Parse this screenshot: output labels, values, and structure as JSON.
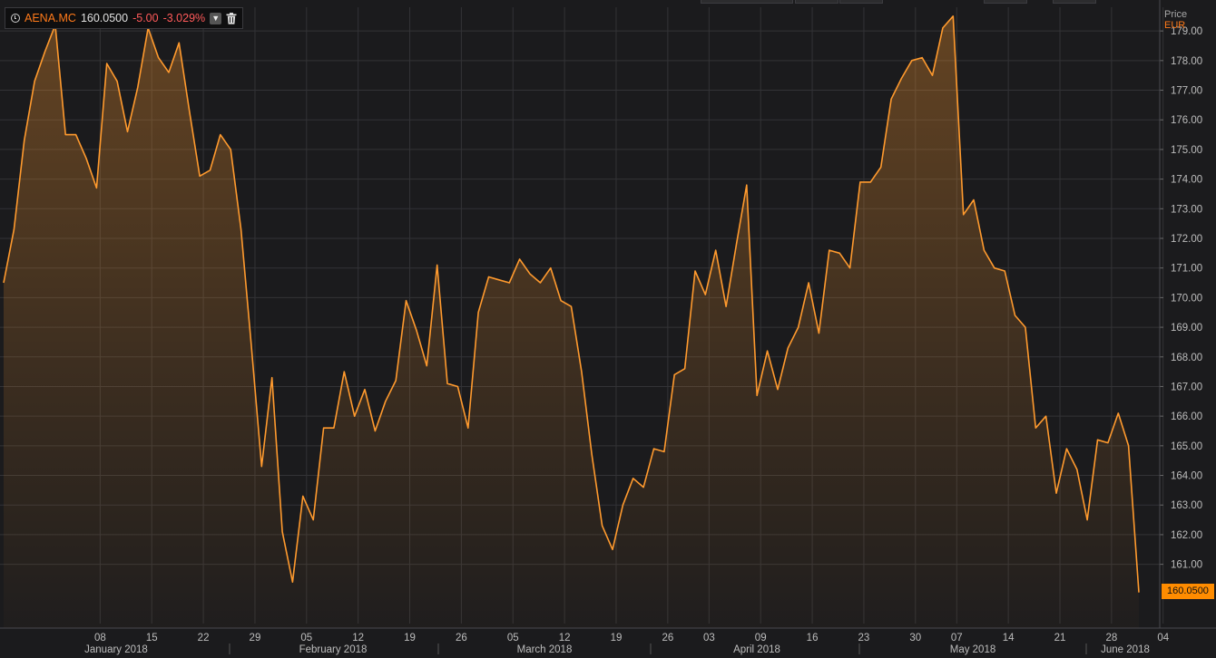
{
  "legend": {
    "ric": "AENA.MC",
    "last": "160.0500",
    "change": "-5.00",
    "change_pct": "-3.029%",
    "icons": [
      "clock-icon",
      "chevron-down-icon",
      "trash-icon"
    ]
  },
  "axis_header": {
    "title": "Price",
    "currency": "EUR"
  },
  "last_price_label": "160.0500",
  "colors": {
    "line": "#ff9a2e",
    "accent": "#ff7a1a",
    "negative": "#ff5a5a",
    "background": "#1b1b1d",
    "grid": "#333336"
  },
  "chart_data": {
    "type": "area",
    "ylim": [
      159.0,
      179.8
    ],
    "y_ticks": [
      "161.00",
      "162.00",
      "163.00",
      "164.00",
      "165.00",
      "166.00",
      "167.00",
      "168.00",
      "169.00",
      "170.00",
      "171.00",
      "172.00",
      "173.00",
      "174.00",
      "175.00",
      "176.00",
      "177.00",
      "178.00",
      "179.00"
    ],
    "day_ticks": [
      "08",
      "15",
      "22",
      "29",
      "05",
      "12",
      "19",
      "26",
      "05",
      "12",
      "19",
      "26",
      "03",
      "09",
      "16",
      "23",
      "30",
      "07",
      "14",
      "21",
      "28",
      "04"
    ],
    "month_labels": [
      "January 2018",
      "February 2018",
      "March 2018",
      "April 2018",
      "May 2018",
      "June 2018"
    ],
    "series": [
      {
        "values": [
          170.5,
          172.3,
          175.3,
          177.3,
          178.3,
          179.2,
          175.5,
          175.5,
          174.7,
          173.7,
          177.9,
          177.3,
          175.6,
          177.1,
          179.1,
          178.1,
          177.6,
          178.6,
          176.3,
          174.1,
          174.3,
          175.5,
          175.0,
          172.3,
          168.4,
          164.3,
          167.3,
          162.1,
          160.4,
          163.3,
          162.5,
          165.6,
          165.6,
          167.5,
          166.0,
          166.9,
          165.5,
          166.5,
          167.2,
          169.9,
          168.9,
          167.7,
          171.1,
          167.1,
          167.0,
          165.6,
          169.5,
          170.7,
          170.6,
          170.5,
          171.3,
          170.8,
          170.5,
          171.0,
          169.9,
          169.7,
          167.5,
          164.7,
          162.3,
          161.5,
          163.0,
          163.9,
          163.6,
          164.9,
          164.8,
          167.4,
          167.6,
          170.9,
          170.1,
          171.6,
          169.7,
          171.8,
          173.8,
          166.7,
          168.2,
          166.9,
          168.3,
          169.0,
          170.5,
          168.8,
          171.6,
          171.5,
          171.0,
          173.9,
          173.9,
          174.4,
          176.7,
          177.4,
          178.0,
          178.1,
          177.5,
          179.1,
          179.5,
          172.8,
          173.3,
          171.6,
          171.0,
          170.9,
          169.4,
          169.0,
          165.6,
          166.0,
          163.4,
          164.9,
          164.2,
          162.5,
          165.2,
          165.1,
          166.1,
          165.0,
          160.05
        ]
      }
    ]
  }
}
